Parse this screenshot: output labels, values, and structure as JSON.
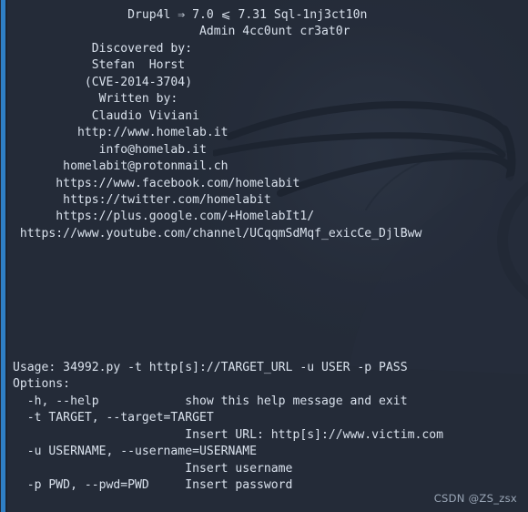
{
  "window": {
    "title": "Terminal",
    "background_color": "#242b38",
    "text_color": "#d9e1ec",
    "accent_bar_color": "#2f7fc4",
    "watermark_icon": "kali-dragon-icon"
  },
  "banner": {
    "title_line_1": "                Drup4l ⇒ 7.0 ⩽ 7.31 Sql-1nj3ct10n",
    "title_line_2": "                          Admin 4cc0unt cr3at0r",
    "blank_1": "",
    "discovered_label": "           Discovered by:",
    "blank_2": "",
    "discoverer_name": "           Stefan  Horst",
    "discoverer_cve": "          (CVE-2014-3704)",
    "blank_3": "",
    "written_label": "            Written by:",
    "blank_4": "",
    "author_name": "           Claudio Viviani",
    "blank_5": "",
    "website": "         http://www.homelab.it",
    "blank_6": "",
    "email_1": "            info@homelab.it",
    "email_2": "       homelabit@protonmail.ch",
    "blank_7": "",
    "social_facebook": "      https://www.facebook.com/homelabit",
    "social_twitter": "       https://twitter.com/homelabit",
    "social_google": "      https://plus.google.com/+HomelabIt1/",
    "social_youtube": " https://www.youtube.com/channel/UCqqmSdMqf_exicCe_DjlBww"
  },
  "usage": {
    "usage_line": "Usage: 34992.py -t http[s]://TARGET_URL -u USER -p PASS",
    "blank_1": "",
    "blank_2": "",
    "options_header": "Options:",
    "opt_help": "  -h, --help            show this help message and exit",
    "opt_target": "  -t TARGET, --target=TARGET",
    "opt_target_desc": "                        Insert URL: http[s]://www.victim.com",
    "opt_username": "  -u USERNAME, --username=USERNAME",
    "opt_username_desc": "                        Insert username",
    "opt_password": "  -p PWD, --pwd=PWD     Insert password"
  },
  "watermark": {
    "csdn_text": "CSDN @ZS_zsx"
  }
}
